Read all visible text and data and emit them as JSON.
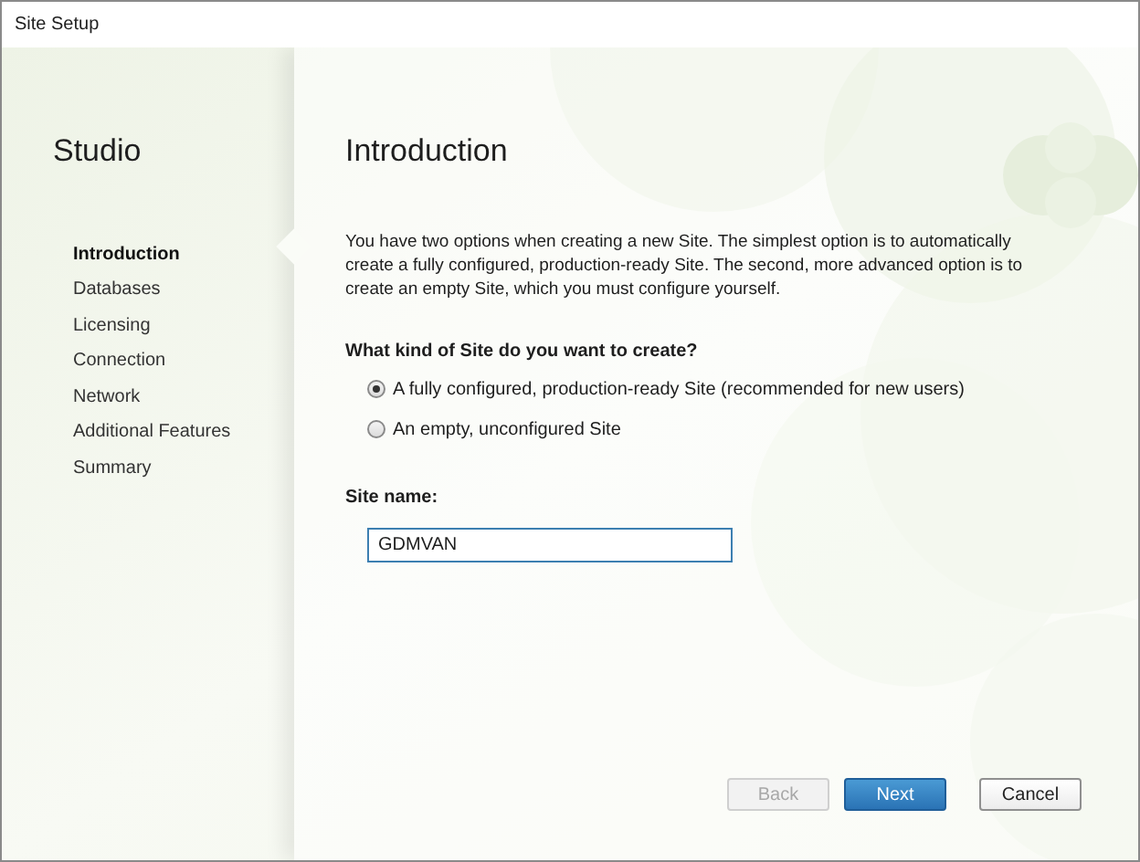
{
  "window": {
    "title": "Site Setup"
  },
  "sidebar": {
    "title": "Studio",
    "items": [
      {
        "label": "Introduction",
        "selected": true
      },
      {
        "label": "Databases",
        "selected": false
      },
      {
        "label": "Licensing",
        "selected": false
      },
      {
        "label": "Connection",
        "selected": false
      },
      {
        "label": "Network",
        "selected": false
      },
      {
        "label": "Additional Features",
        "selected": false
      },
      {
        "label": "Summary",
        "selected": false
      }
    ]
  },
  "page": {
    "title": "Introduction",
    "description": "You have two options when creating a new Site. The simplest option is to automatically create a fully configured, production-ready Site. The second, more advanced option is to create an empty Site, which you must configure yourself.",
    "question": "What kind of Site do you want to create?",
    "options": [
      {
        "label": "A fully configured, production-ready Site (recommended for new users)",
        "selected": true
      },
      {
        "label": "An empty, unconfigured Site",
        "selected": false
      }
    ],
    "site_name": {
      "label": "Site name:",
      "value": "GDMVAN"
    }
  },
  "buttons": [
    {
      "label": "Back",
      "kind": "secondary",
      "disabled": true
    },
    {
      "label": "Next",
      "kind": "primary",
      "disabled": false
    },
    {
      "label": "Cancel",
      "kind": "secondary",
      "disabled": false
    }
  ]
}
